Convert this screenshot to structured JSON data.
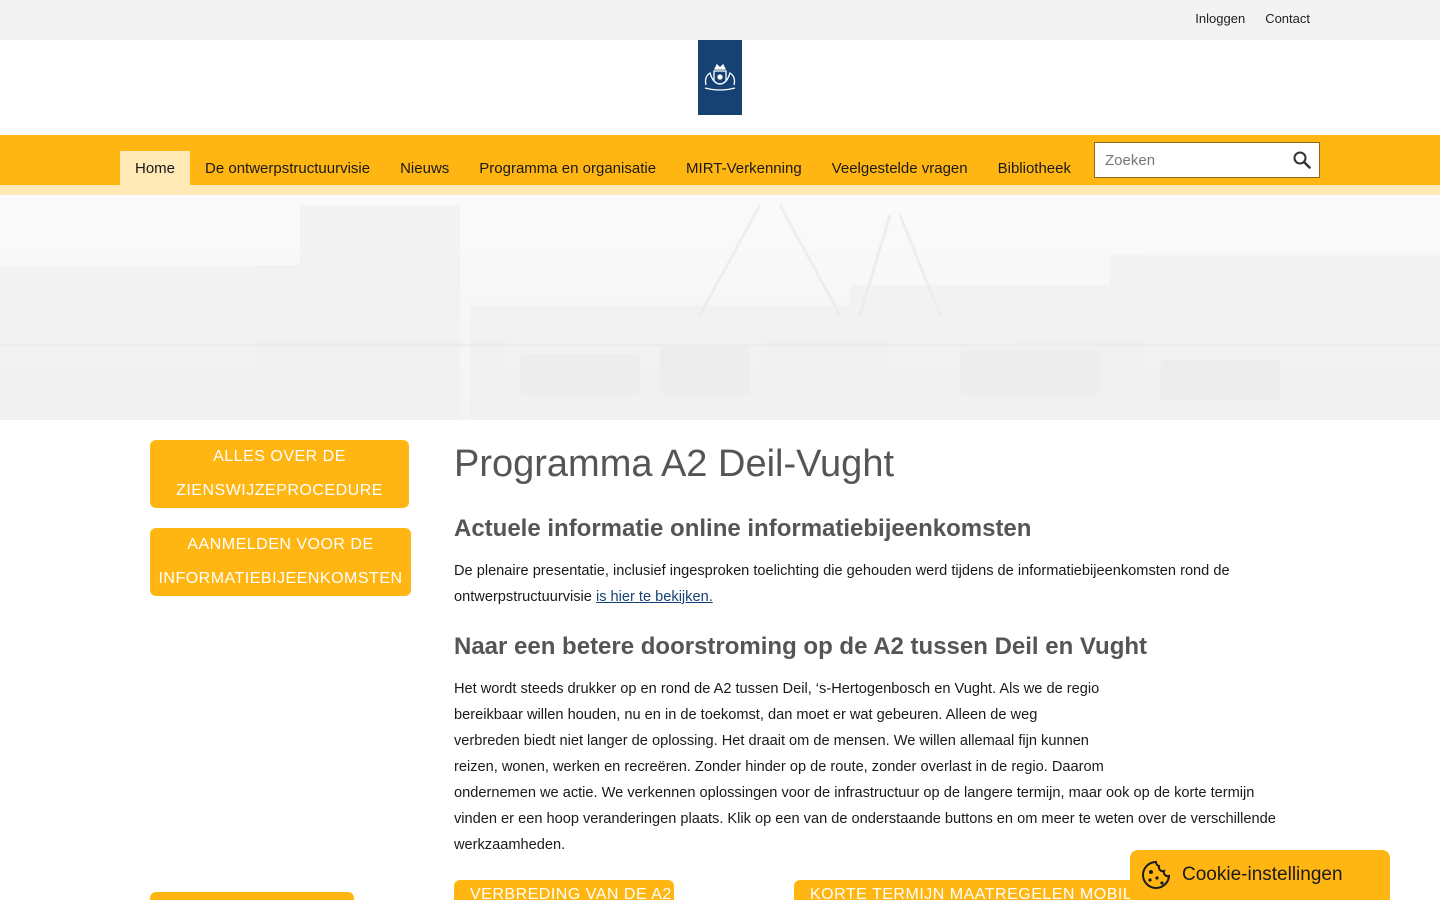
{
  "topbar": {
    "login": "Inloggen",
    "contact": "Contact"
  },
  "nav": {
    "items": [
      {
        "label": "Home"
      },
      {
        "label": "De ontwerpstructuurvisie"
      },
      {
        "label": "Nieuws"
      },
      {
        "label": "Programma en organisatie"
      },
      {
        "label": "MIRT-Verkenning"
      },
      {
        "label": "Veelgestelde vragen"
      },
      {
        "label": "Bibliotheek"
      }
    ]
  },
  "search": {
    "placeholder": "Zoeken",
    "icon": "search-icon"
  },
  "sidebar": {
    "buttons": [
      {
        "line1": "ALLES OVER DE",
        "line2": "ZIENSWIJZEPROCEDURE"
      },
      {
        "line1": "AANMELDEN VOOR DE",
        "line2": "INFORMATIEBIJEENKOMSTEN"
      }
    ]
  },
  "main": {
    "title": "Programma A2 Deil-Vught",
    "h2a": "Actuele informatie online informatiebijeenkomsten",
    "p1_text": "De plenaire presentatie, inclusief ingesproken toelichting die gehouden werd tijdens de informatiebijeenkomsten rond de ontwerpstructuurvisie ",
    "p1_link": "is hier te bekijken. ",
    "h2b": "Naar een betere doorstroming op de A2 tussen Deil en Vught",
    "p2_lines": [
      "Het wordt steeds drukker op en rond de A2 tussen Deil, ‘s-Hertogenbosch en Vught. Als we de regio",
      "bereikbaar willen houden, nu en in de toekomst, dan moet er wat gebeuren. Alleen de weg",
      "verbreden biedt niet langer de oplossing. Het draait om de mensen. We willen allemaal fijn kunnen",
      "reizen, wonen, werken en recreëren. Zonder hinder op de route, zonder overlast in de regio. Daarom",
      "ondernemen we actie. We verkennen oplossingen voor de infrastructuur op de langere termijn, maar ook op de korte termijn",
      "vinden er een hoop veranderingen plaats. Klik op een van de onderstaande buttons en om meer te weten over de verschillende",
      "werkzaamheden."
    ]
  },
  "ctas": [
    {
      "label": "VERBREDING VAN DE A2"
    },
    {
      "label": "KORTE TERMIJN MAATREGELEN MOBILITEIT"
    }
  ],
  "cookie": {
    "label": "Cookie-instellingen",
    "icon": "cookie-icon"
  },
  "colors": {
    "brand_yellow": "#ffb612",
    "nav_active": "#ffe9b7",
    "logo_blue": "#154273"
  }
}
